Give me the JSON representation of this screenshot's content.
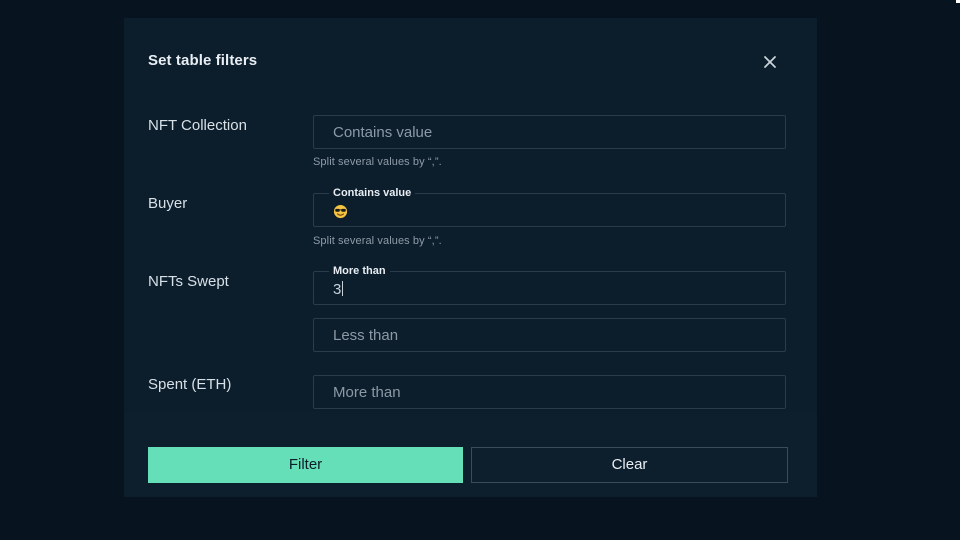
{
  "modal": {
    "title": "Set table filters"
  },
  "filters": {
    "nft_collection": {
      "label": "NFT Collection",
      "placeholder": "Contains value",
      "helper": "Split several values by “,”."
    },
    "buyer": {
      "label": "Buyer",
      "float_label": "Contains value",
      "value_icon": "smiling-face-with-sunglasses-emoji",
      "helper": "Split several values by “,”."
    },
    "nfts_swept": {
      "label": "NFTs Swept",
      "more_than_label": "More than",
      "more_than_value": "3",
      "less_than_placeholder": "Less than"
    },
    "spent_eth": {
      "label": "Spent (ETH)",
      "more_than_placeholder": "More than"
    }
  },
  "actions": {
    "filter_label": "Filter",
    "clear_label": "Clear"
  },
  "colors": {
    "background": "#07141f",
    "modal_background": "#0c1d2b",
    "accent": "#64dfb7",
    "border": "#2a3b4a"
  }
}
